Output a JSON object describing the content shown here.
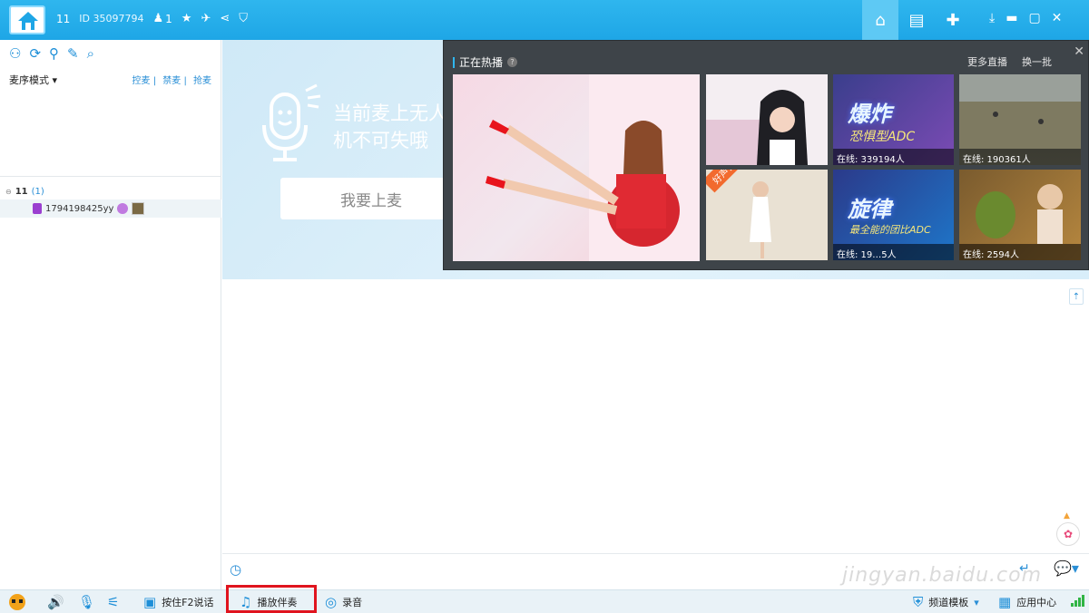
{
  "topbar": {
    "channel_num": "11",
    "channel_id": "ID 35097794",
    "online_count": "1",
    "icons": [
      "user-icon",
      "star-icon",
      "plane-icon",
      "share-icon",
      "shield-icon"
    ],
    "right_tabs": [
      "home-icon",
      "news-icon",
      "game-icon"
    ],
    "window_controls": [
      "download-icon",
      "minimize-icon",
      "maximize-icon",
      "close-icon"
    ]
  },
  "left": {
    "tool_icons": [
      "user-tool-icon",
      "refresh-tool-icon",
      "location-tool-icon",
      "edit-tool-icon",
      "search-tool-icon"
    ],
    "mode_label": "麦序模式",
    "links": [
      "控麦",
      "禁麦",
      "抢麦"
    ],
    "channel_name": "11",
    "channel_count": "(1)",
    "user_name": "1794198425yy"
  },
  "stage": {
    "mic_text_line1": "当前麦上无人",
    "mic_text_line2": "机不可失哦",
    "mic_button": "我要上麦"
  },
  "hot": {
    "title": "正在热播",
    "more": "更多直播",
    "refresh": "换一批",
    "tiles": [
      {
        "online": ""
      },
      {
        "online": ""
      },
      {
        "title": "爆炸",
        "sub": "恐惧型ADC",
        "online": "在线: 339194人"
      },
      {
        "online": "在线: 190361人"
      },
      {
        "ribbon": "好声音",
        "online": ""
      },
      {
        "title": "旋律",
        "sub": "最全能的团比ADC",
        "online": "在线: 19…5人"
      },
      {
        "online": "在线: 2594人"
      }
    ]
  },
  "bottom": {
    "talk_label": "按住F2说话",
    "music_label": "播放伴奏",
    "record_label": "录音",
    "template_label": "频道模板",
    "app_center_label": "应用中心"
  },
  "watermark": "jingyan.baidu.com",
  "colors": {
    "brand_blue": "#1ea6e6",
    "highlight_red": "#e0141e",
    "hot_panel_bg": "#3e4449"
  }
}
